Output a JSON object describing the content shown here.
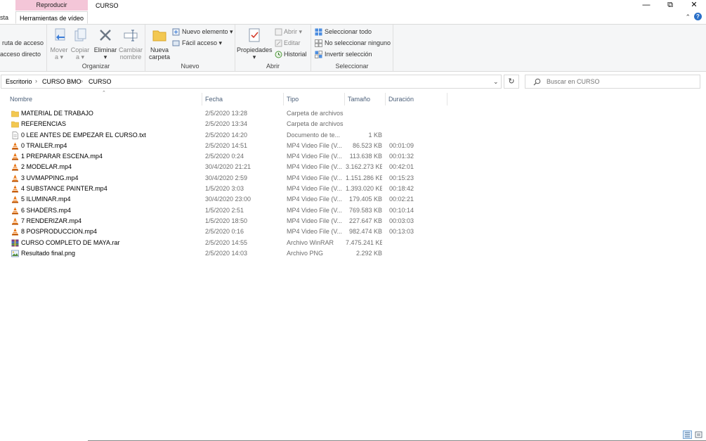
{
  "window": {
    "context_group": "Reproducir",
    "title": "CURSO",
    "minimize": "—",
    "restore": "⧉",
    "close": "✕"
  },
  "ribbon_tabs": {
    "partial_left": "sta",
    "active": "Herramientas de vídeo",
    "collapse": "⌃",
    "help": "?"
  },
  "ribbon": {
    "portapapeles_partial": {
      "item1": "ruta de acceso",
      "item2": "acceso directo"
    },
    "organizar": {
      "label": "Organizar",
      "mover": "Mover",
      "mover_sub": "a ▾",
      "copiar": "Copiar",
      "copiar_sub": "a ▾",
      "eliminar": "Eliminar",
      "eliminar_sub": "▾",
      "cambiar": "Cambiar",
      "cambiar_sub": "nombre"
    },
    "nuevo": {
      "label": "Nuevo",
      "nueva": "Nueva",
      "nueva_sub": "carpeta",
      "nuevo_elemento": "Nuevo elemento ▾",
      "facil_acceso": "Fácil acceso ▾"
    },
    "abrir": {
      "label": "Abrir",
      "propiedades": "Propiedades",
      "propiedades_sub": "▾",
      "abrir": "Abrir ▾",
      "editar": "Editar",
      "historial": "Historial"
    },
    "seleccionar": {
      "label": "Seleccionar",
      "todo": "Seleccionar todo",
      "ninguno": "No seleccionar ninguno",
      "invertir": "Invertir selección"
    }
  },
  "address": {
    "crumbs": [
      "Escritorio",
      "CURSO BMO",
      "CURSO"
    ],
    "separator": "›",
    "dropdown": "⌄",
    "refresh": "↻"
  },
  "search": {
    "placeholder": "Buscar en CURSO"
  },
  "columns": {
    "sort_indicator": "⌃",
    "nombre": "Nombre",
    "fecha": "Fecha",
    "tipo": "Tipo",
    "tamano": "Tamaño",
    "duracion": "Duración"
  },
  "files": [
    {
      "name": "MATERIAL DE TRABAJO",
      "date": "2/5/2020 13:28",
      "type": "Carpeta de archivos",
      "size": "",
      "duration": "",
      "icon": "folder"
    },
    {
      "name": "REFERENCIAS",
      "date": "2/5/2020 13:34",
      "type": "Carpeta de archivos",
      "size": "",
      "duration": "",
      "icon": "folder"
    },
    {
      "name": "0 LEE ANTES DE EMPEZAR EL CURSO.txt",
      "date": "2/5/2020 14:20",
      "type": "Documento de te...",
      "size": "1 KB",
      "duration": "",
      "icon": "text"
    },
    {
      "name": "0 TRAILER.mp4",
      "date": "2/5/2020 14:51",
      "type": "MP4 Video File (V...",
      "size": "86.523 KB",
      "duration": "00:01:09",
      "icon": "vlc"
    },
    {
      "name": "1 PREPARAR ESCENA.mp4",
      "date": "2/5/2020 0:24",
      "type": "MP4 Video File (V...",
      "size": "113.638 KB",
      "duration": "00:01:32",
      "icon": "vlc"
    },
    {
      "name": "2 MODELAR.mp4",
      "date": "30/4/2020 21:21",
      "type": "MP4 Video File (V...",
      "size": "3.162.273 KB",
      "duration": "00:42:01",
      "icon": "vlc"
    },
    {
      "name": "3 UVMAPPING.mp4",
      "date": "30/4/2020 2:59",
      "type": "MP4 Video File (V...",
      "size": "1.151.286 KB",
      "duration": "00:15:23",
      "icon": "vlc"
    },
    {
      "name": "4 SUBSTANCE PAINTER.mp4",
      "date": "1/5/2020 3:03",
      "type": "MP4 Video File (V...",
      "size": "1.393.020 KB",
      "duration": "00:18:42",
      "icon": "vlc"
    },
    {
      "name": "5 ILUMINAR.mp4",
      "date": "30/4/2020 23:00",
      "type": "MP4 Video File (V...",
      "size": "179.405 KB",
      "duration": "00:02:21",
      "icon": "vlc"
    },
    {
      "name": "6 SHADERS.mp4",
      "date": "1/5/2020 2:51",
      "type": "MP4 Video File (V...",
      "size": "769.583 KB",
      "duration": "00:10:14",
      "icon": "vlc"
    },
    {
      "name": "7 RENDERIZAR.mp4",
      "date": "1/5/2020 18:50",
      "type": "MP4 Video File (V...",
      "size": "227.647 KB",
      "duration": "00:03:03",
      "icon": "vlc"
    },
    {
      "name": "8 POSPRODUCCION.mp4",
      "date": "2/5/2020 0:16",
      "type": "MP4 Video File (V...",
      "size": "982.474 KB",
      "duration": "00:13:03",
      "icon": "vlc"
    },
    {
      "name": "CURSO COMPLETO DE MAYA.rar",
      "date": "2/5/2020 14:55",
      "type": "Archivo WinRAR",
      "size": "7.475.241 KB",
      "duration": "",
      "icon": "rar"
    },
    {
      "name": "Resultado final.png",
      "date": "2/5/2020 14:03",
      "type": "Archivo PNG",
      "size": "2.292 KB",
      "duration": "",
      "icon": "png"
    }
  ],
  "colors": {
    "context_tab": "#f4c6d8",
    "header_text": "#4c607a",
    "folder": "#f3c851",
    "vlc": "#e8700a"
  }
}
